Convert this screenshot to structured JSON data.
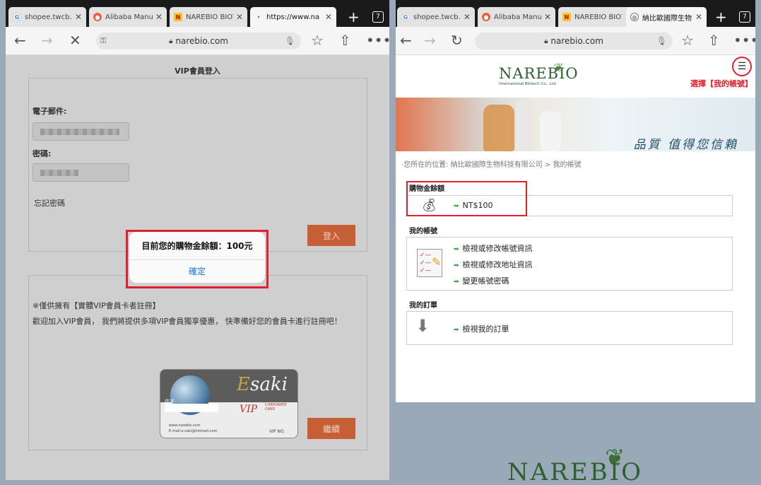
{
  "left": {
    "tabs": [
      {
        "icon": "google-favicon",
        "title": "shopee.twcb.c"
      },
      {
        "icon": "alibaba-favicon",
        "title": "Alibaba Manufa"
      },
      {
        "icon": "narebio-favicon",
        "title": "NAREBIO BIOT"
      },
      {
        "icon": "loading-favicon",
        "title": "https://www.na"
      }
    ],
    "tab_count": "7",
    "url": "narebio.com",
    "page_title": "VIP會員登入",
    "email_label": "電子郵件:",
    "password_label": "密碼:",
    "forgot_label": "忘記密碼",
    "login_button": "登入",
    "register_note": "※僅供擁有【實體VIP會員卡者註冊】",
    "register_desc": "歡迎加入VIP會員， 我們將提供多項VIP會員獨享優惠， 快準備好您的會員卡進行註冊吧！",
    "continue_button": "繼續",
    "card": {
      "brand_e": "E",
      "brand_rest": "saki",
      "vip": "VIP",
      "corporate": "CORPORATE",
      "card_word": "CARD",
      "store_label": "店家:",
      "website": "www.narebio.com",
      "email": "E-mail:e-saki@hotmail.com",
      "vip_no": "VIP NO."
    },
    "alert": {
      "message": "目前您的購物金餘額：100元",
      "ok": "確定"
    }
  },
  "right": {
    "tabs": [
      {
        "icon": "google-favicon",
        "title": "shopee.twcb.c"
      },
      {
        "icon": "alibaba-favicon",
        "title": "Alibaba Manufa"
      },
      {
        "icon": "narebio-favicon",
        "title": "NAREBIO BIOT"
      },
      {
        "icon": "globe-favicon",
        "title": "納比歐國際生物"
      }
    ],
    "tab_count": "7",
    "url": "narebio.com",
    "logo": "NAREBIO",
    "logo_sub": "International Biotech Co., Ltd.",
    "select_note": "選擇【我的帳號】",
    "slogan": "品質 值得您信賴",
    "breadcrumb": "·您所在的位置: 納比歐國際生物科技有限公司 > 我的帳號",
    "balance_title": "購物金餘額",
    "balance_value": "NT$100",
    "account_title": "我的帳號",
    "account_links": [
      "檢視或修改帳號資訊",
      "檢視或修改地址資訊",
      "變更帳號密碼"
    ],
    "orders_title": "我的訂單",
    "orders_link": "檢視我的訂單",
    "footer_logo": "NAREBIO"
  }
}
